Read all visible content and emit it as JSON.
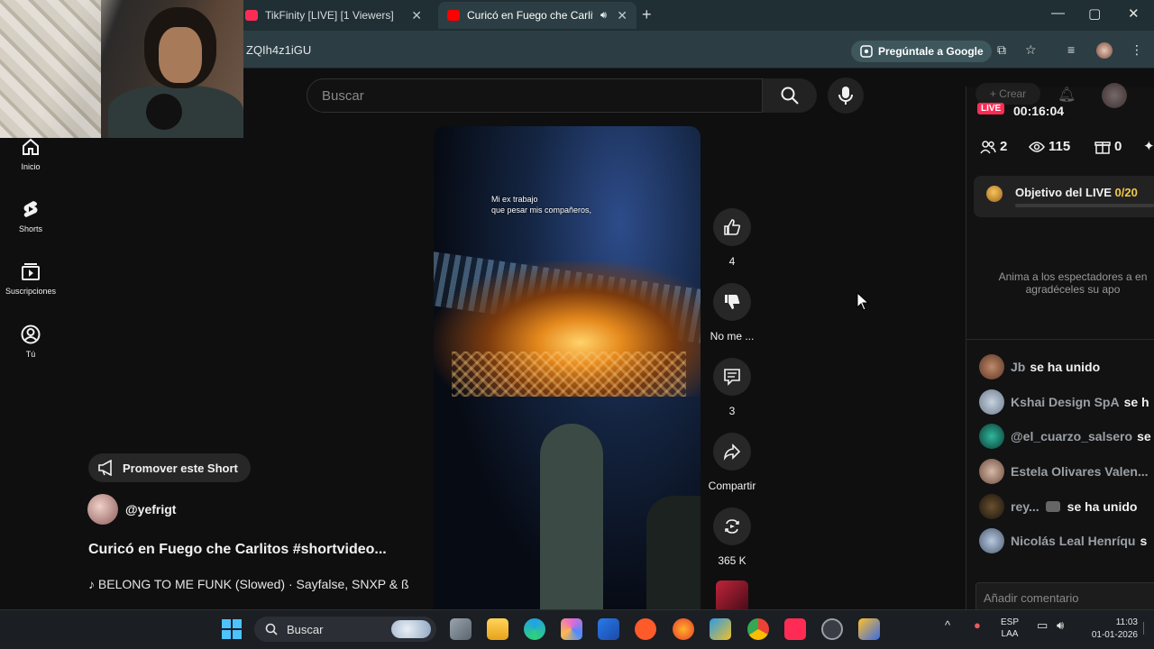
{
  "browser": {
    "tabs": [
      {
        "label": "TikFinity [LIVE] [1 Viewers]",
        "active": false,
        "favicon_color": "#fe2c55"
      },
      {
        "label": "Curicó en Fuego che Carlito",
        "active": true,
        "favicon_color": "#ff0000"
      }
    ],
    "close_glyph": "✕",
    "new_tab_glyph": "+",
    "url_fragment": "ZQIh4z1iGU",
    "ask_google_label": "Pregúntale a Google",
    "window_buttons": [
      "—",
      "▢",
      "✕"
    ]
  },
  "youtube": {
    "search_placeholder": "Buscar",
    "nav": [
      {
        "label": "Inicio",
        "icon": "home-icon"
      },
      {
        "label": "Shorts",
        "icon": "shorts-icon"
      },
      {
        "label": "Suscripciones",
        "icon": "subscriptions-icon"
      },
      {
        "label": "Tú",
        "icon": "you-icon"
      }
    ],
    "short": {
      "caption_line1": "Mi ex trabajo",
      "caption_line2": "que pesar mis compañeros,",
      "promote_label": "Promover este Short",
      "channel": "@yefrigt",
      "title": "Curicó en Fuego che Carlitos #shortvideo...",
      "music": "BELONG TO ME FUNK (Slowed) · Sayfalse, SNXP & ß"
    },
    "actions": {
      "like_count": "4",
      "dislike_label": "No me ...",
      "comments_count": "3",
      "share_label": "Compartir",
      "remix_count": "365 K"
    }
  },
  "tikfinity": {
    "crear_label": "Crear",
    "live_badge": "LIVE",
    "live_time": "00:16:04",
    "stats": {
      "users": "2",
      "views": "115",
      "gifts": "0"
    },
    "goal_label": "Objetivo del LIVE",
    "goal_progress": "0/20",
    "note_line1": "Anima a los espectadores a en",
    "note_line2": "agradéceles su apo",
    "chat": [
      {
        "user": "Jb",
        "msg": "se ha unido",
        "avatar_color": "#8a5a44"
      },
      {
        "user": "Kshai Design SpA",
        "msg": "se h",
        "avatar_color": "#9aa7b8"
      },
      {
        "user": "@el_cuarzo_salsero",
        "msg": "se",
        "avatar_color": "#1f7a6a"
      },
      {
        "user": "Estela Olivares Valen...",
        "msg": "",
        "avatar_color": "#b08a7a"
      },
      {
        "user": "rey...",
        "msg": "se ha unido",
        "avatar_color": "#3a2d20"
      },
      {
        "user": "Nicolás Leal Henríqu",
        "msg": "s",
        "avatar_color": "#7a8ea8"
      }
    ],
    "comment_placeholder": "Añadir comentario"
  },
  "taskbar": {
    "search_label": "Buscar",
    "lang_line1": "ESP",
    "lang_line2": "LAA",
    "time": "11:03",
    "date": "01-01-2026"
  },
  "colors": {
    "accent_red": "#fe2c55",
    "goal_yellow": "#f2c94c",
    "chrome_bg": "#2c3e43"
  }
}
